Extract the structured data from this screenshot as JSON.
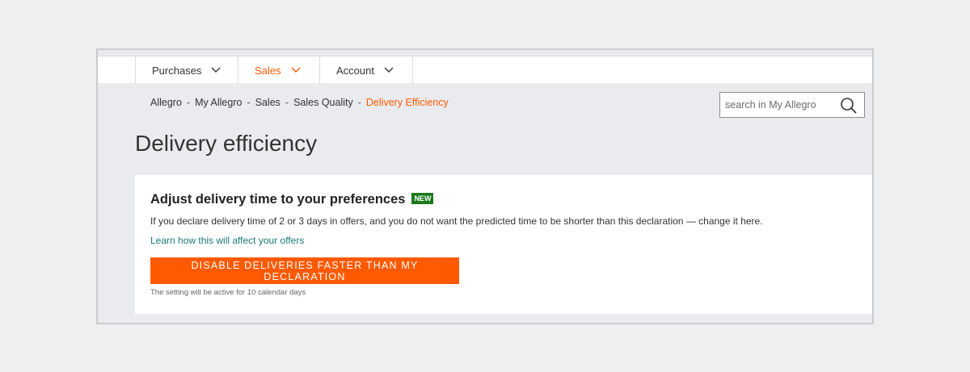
{
  "nav": {
    "items": [
      {
        "label": "Purchases",
        "active": false
      },
      {
        "label": "Sales",
        "active": true
      },
      {
        "label": "Account",
        "active": false
      }
    ]
  },
  "breadcrumb": {
    "items": [
      "Allegro",
      "My Allegro",
      "Sales",
      "Sales Quality"
    ],
    "separator": "-",
    "current": "Delivery Efficiency"
  },
  "search": {
    "placeholder": "search in My Allegro",
    "icon": "search-icon"
  },
  "page": {
    "title": "Delivery efficiency"
  },
  "card": {
    "title": "Adjust delivery time to your preferences",
    "badge": "NEW",
    "description": "If you declare delivery time of 2 or 3 days in offers, and you do not want the predicted time to be shorter than this declaration — change it here.",
    "link": "Learn how this will affect your offers",
    "button_label": "Disable deliveries faster than my declaration",
    "note": "The setting will be active for 10 calendar days"
  },
  "colors": {
    "accent": "#ff5a00",
    "badge": "#1a7a1a",
    "link": "#1a7a74",
    "background": "#e9ebee"
  }
}
